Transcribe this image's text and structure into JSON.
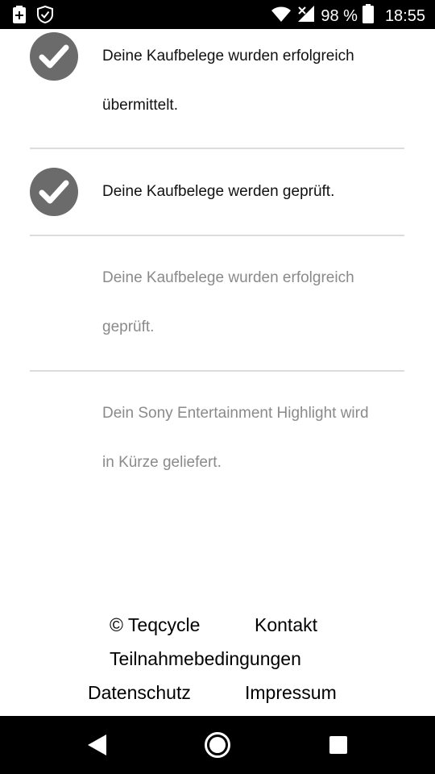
{
  "status_bar": {
    "left_icons": [
      "battery-saver-icon",
      "shield-check-icon"
    ],
    "right_icons": [
      "wifi-icon",
      "signal-icon",
      "battery-icon"
    ],
    "battery": "98 %",
    "time": "18:55"
  },
  "steps": [
    {
      "line1": "Deine Kaufbelege wurden erfolgreich",
      "line2": "übermittelt.",
      "status": "done"
    },
    {
      "line1": "Deine Kaufbelege werden geprüft.",
      "line2": "",
      "status": "done"
    },
    {
      "line1": "Deine Kaufbelege wurden erfolgreich",
      "line2": "geprüft.",
      "status": "pending"
    },
    {
      "line1": "Dein Sony Entertainment Highlight wird",
      "line2": "in Kürze geliefert.",
      "status": "pending"
    }
  ],
  "footer": {
    "copyright": "© Teqcycle",
    "kontakt": "Kontakt",
    "teilnahme": "Teilnahmebedingungen",
    "datenschutz": "Datenschutz",
    "impressum": "Impressum"
  },
  "nav": [
    "back-icon",
    "home-icon",
    "recents-icon"
  ],
  "colors": {
    "check_bg": "#6b6b6b",
    "done_text": "#111111",
    "pending_text": "#8a8a8a",
    "divider": "#dcdcdc"
  }
}
